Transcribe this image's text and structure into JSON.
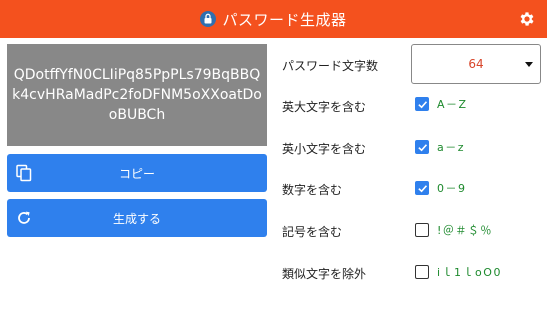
{
  "header": {
    "title": "パスワード生成器",
    "accent": "#f4511e"
  },
  "password": {
    "value": "QDotffYfN0CLIiPq85PpPLs79BqBBQk4cvHRaMadPc2foDFNM5oXXoatDooBUBCh"
  },
  "buttons": {
    "copy_label": "コピー",
    "generate_label": "生成する"
  },
  "settings": {
    "length": {
      "label": "パスワード文字数",
      "value": "64"
    },
    "options": [
      {
        "label": "英大文字を含む",
        "sample": "A－Z",
        "checked": true
      },
      {
        "label": "英小文字を含む",
        "sample": "a－z",
        "checked": true
      },
      {
        "label": "数字を含む",
        "sample": "0－9",
        "checked": true
      },
      {
        "label": "記号を含む",
        "sample": "!＠＃＄％",
        "checked": false
      },
      {
        "label": "類似文字を除外",
        "sample": "iｌ1ｌoO0",
        "checked": false
      }
    ]
  },
  "colors": {
    "button": "#2f80ed",
    "password_bg": "#888888",
    "sample_text": "#1e8a2e",
    "length_value": "#d8452a"
  }
}
